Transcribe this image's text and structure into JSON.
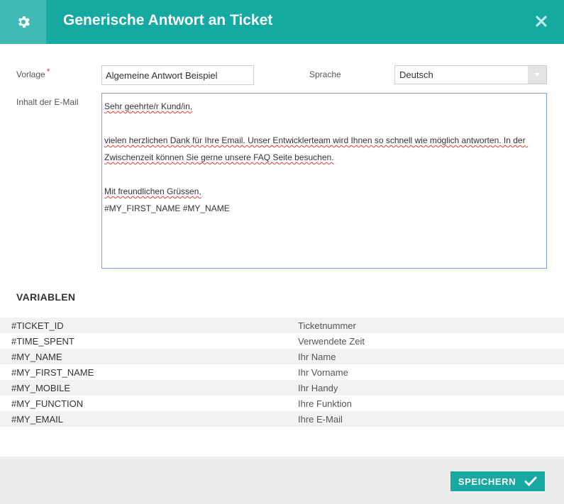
{
  "header": {
    "title": "Generische Antwort an Ticket",
    "settings_icon": "gear-icon",
    "close_icon": "close-icon",
    "accent_color": "#16a9a2"
  },
  "form": {
    "template_label": "Vorlage",
    "required_marker": "*",
    "template_value": "Algemeine Antwort Beispiel",
    "language_label": "Sprache",
    "language_value": "Deutsch",
    "content_label": "Inhalt der E-Mail",
    "body": {
      "greeting": "Sehr geehrte/r Kund/in,",
      "paragraph": "vielen herzlichen Dank für Ihre Email. Unser Entwicklerteam wird Ihnen so schnell wie möglich antworten. In der Zwischenzeit können Sie gerne unsere FAQ Seite besuchen.",
      "closing": "Mit freundlichen Grüssen,",
      "signature": "#MY_FIRST_NAME #MY_NAME"
    }
  },
  "variables": {
    "title": "VARIABLEN",
    "rows": [
      {
        "name": "#TICKET_ID",
        "desc": "Ticketnummer"
      },
      {
        "name": "#TIME_SPENT",
        "desc": "Verwendete Zeit"
      },
      {
        "name": "#MY_NAME",
        "desc": "Ihr Name"
      },
      {
        "name": "#MY_FIRST_NAME",
        "desc": "Ihr Vorname"
      },
      {
        "name": "#MY_MOBILE",
        "desc": "Ihr Handy"
      },
      {
        "name": "#MY_FUNCTION",
        "desc": "Ihre Funktion"
      },
      {
        "name": "#MY_EMAIL",
        "desc": "Ihre E-Mail"
      }
    ]
  },
  "footer": {
    "save_label": "SPEICHERN",
    "save_icon": "checkmark-icon"
  }
}
